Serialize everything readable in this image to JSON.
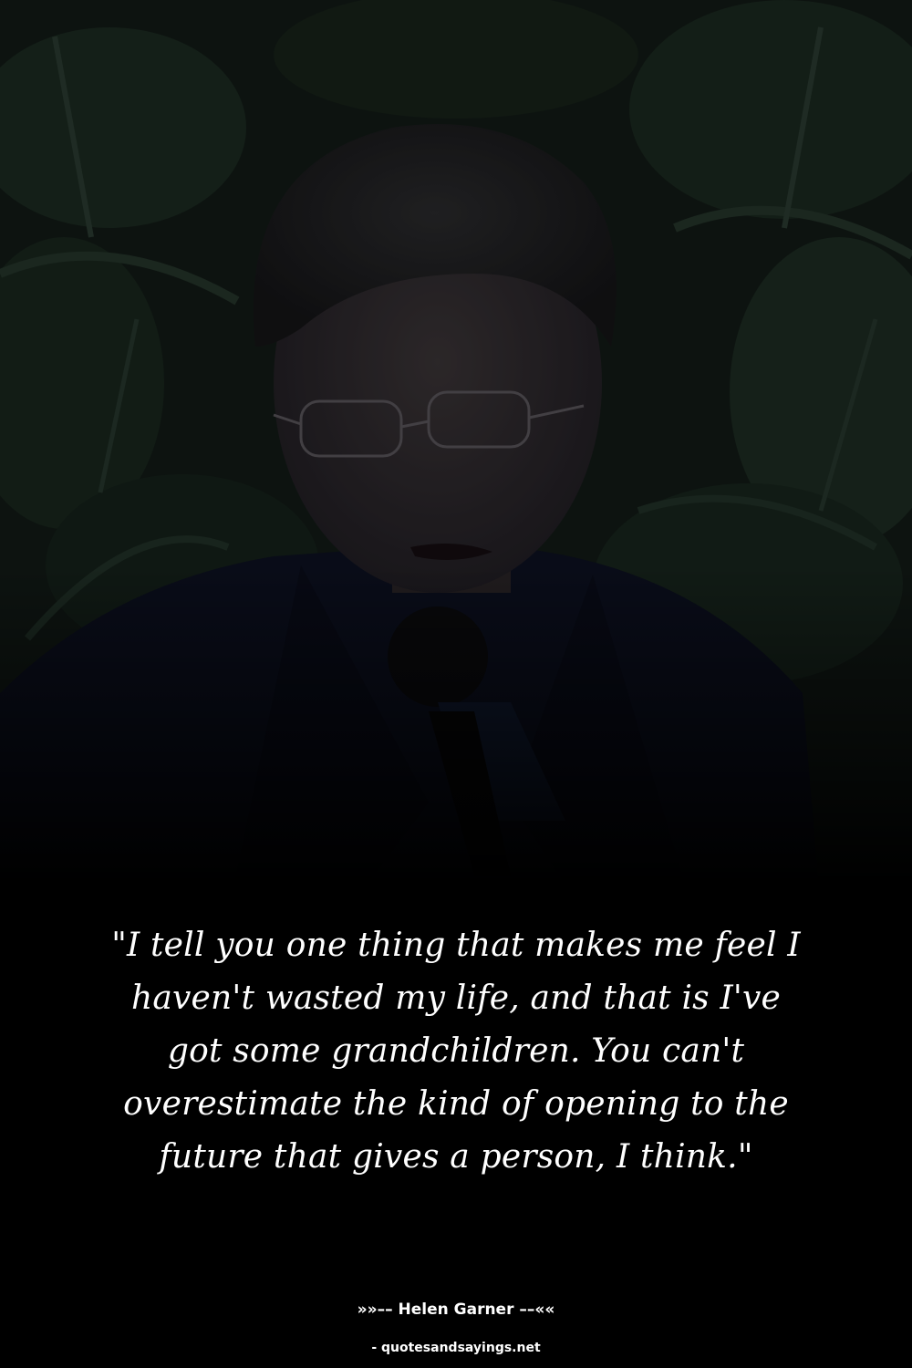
{
  "quote": {
    "text": "\"I tell you one thing that makes me feel I haven't wasted my life, and that is I've got some grandchildren. You can't overestimate the kind of opening to the future that gives a person, I think.\""
  },
  "attribution": {
    "author_line": "»»–– Helen Garner ––««"
  },
  "source": {
    "site": "- quotesandsayings.net"
  },
  "colors": {
    "background": "#000000",
    "text": "#ffffff",
    "foliage_dark": "#0f1a14",
    "foliage_mid": "#1c2a20",
    "jacket": "#0c1020"
  }
}
